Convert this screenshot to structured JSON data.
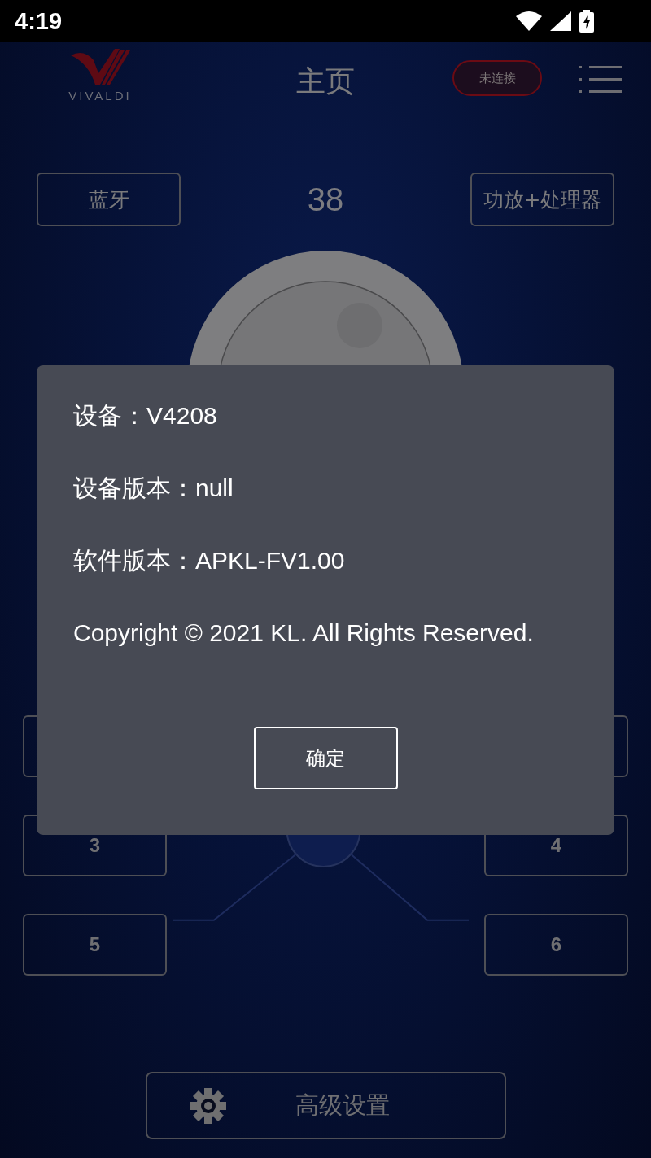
{
  "status_bar": {
    "time": "4:19"
  },
  "header": {
    "logo_text": "VIVALDI",
    "title": "主页",
    "connection_badge": "未连接"
  },
  "top_row": {
    "left_button": "蓝牙",
    "volume": "38",
    "right_button": "功放+处理器"
  },
  "channel_buttons": [
    {
      "label": "3"
    },
    {
      "label": "4"
    },
    {
      "label": "5"
    },
    {
      "label": "6"
    }
  ],
  "settings_button": "高级设置",
  "dialog": {
    "lines": [
      "设备：V4208",
      "设备版本：null",
      "软件版本：APKL-FV1.00",
      "Copyright © 2021 KL. All Rights Reserved."
    ],
    "ok_button": "确定"
  }
}
